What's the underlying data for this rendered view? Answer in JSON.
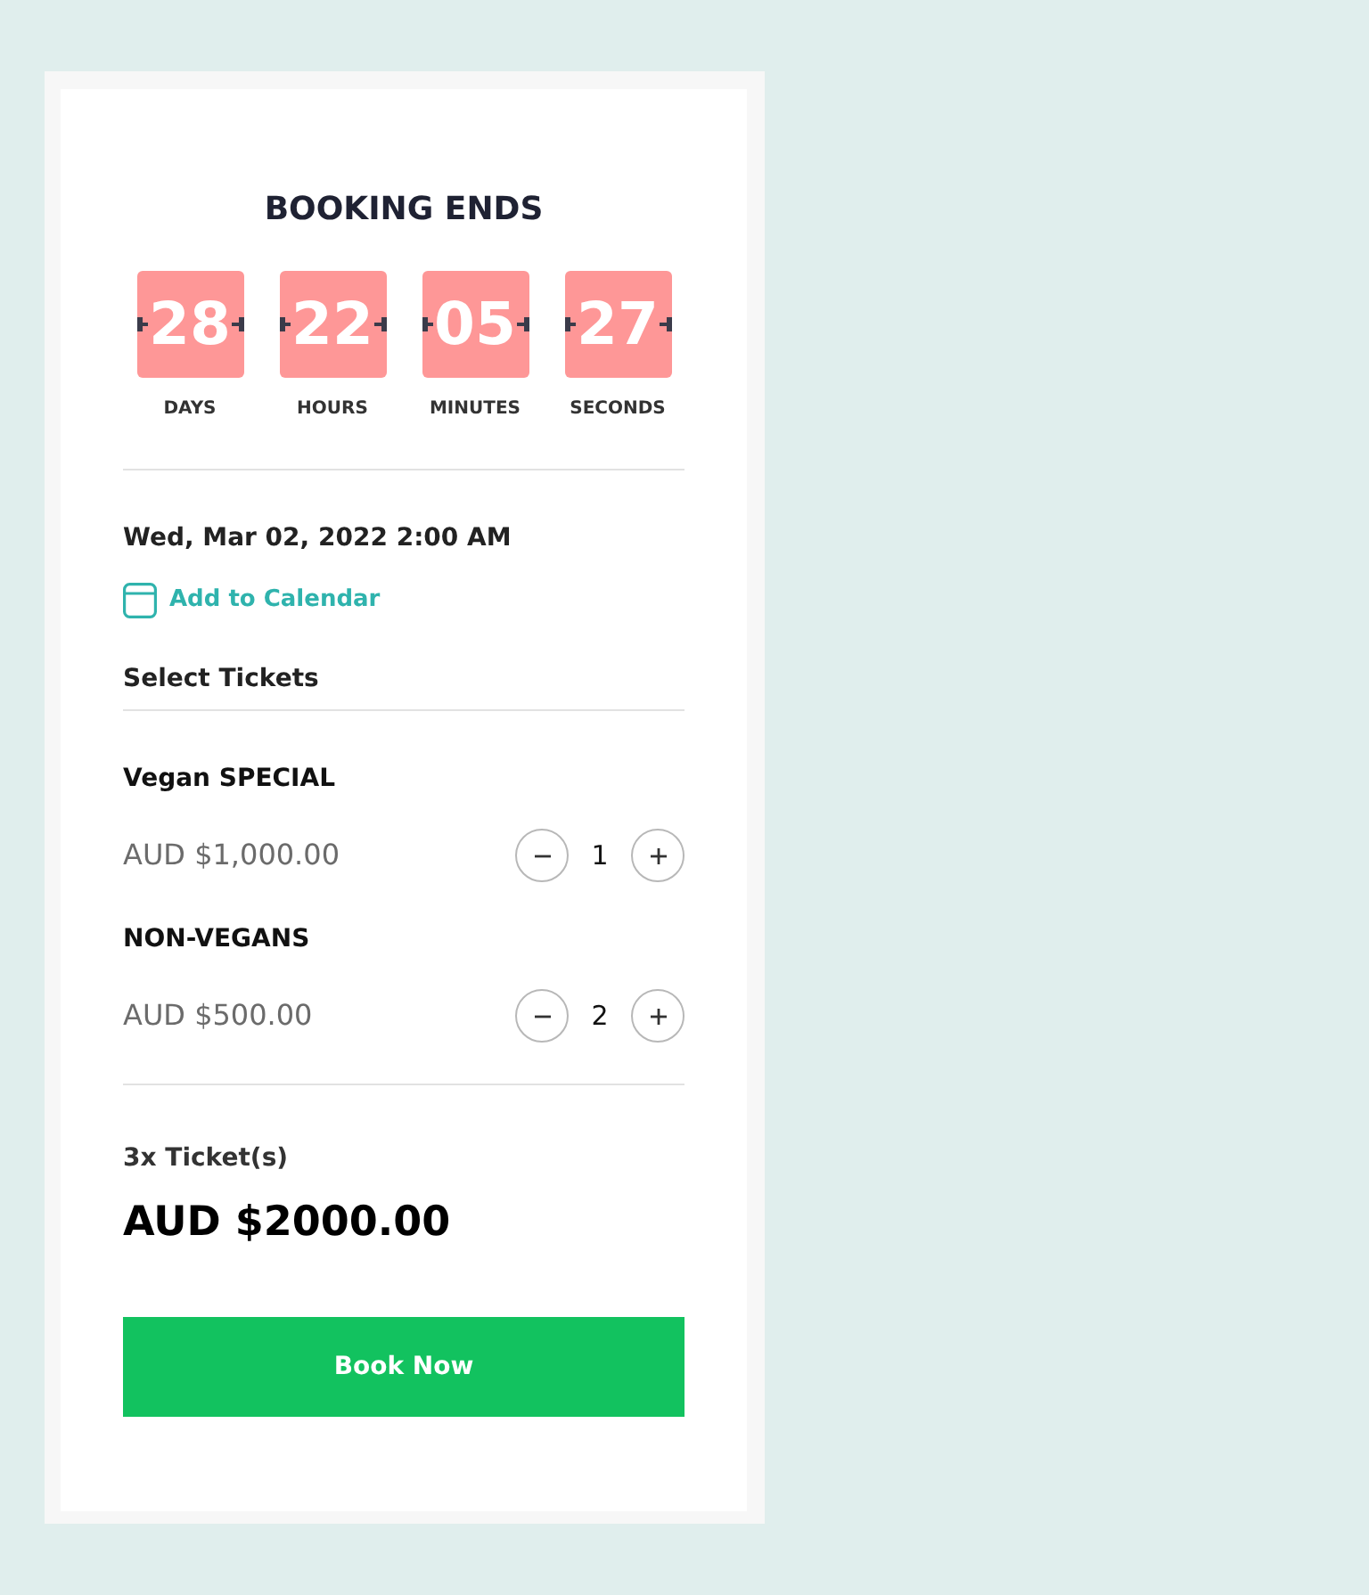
{
  "heading": "BOOKING ENDS",
  "countdown": [
    {
      "value": "28",
      "label": "DAYS"
    },
    {
      "value": "22",
      "label": "HOURS"
    },
    {
      "value": "05",
      "label": "MINUTES"
    },
    {
      "value": "27",
      "label": "SECONDS"
    }
  ],
  "date": "Wed, Mar 02, 2022 2:00 AM",
  "calendar_link": "Add to Calendar",
  "tickets_heading": "Select Tickets",
  "tickets": [
    {
      "name": "Vegan SPECIAL",
      "price": "AUD $1,000.00",
      "quantity": "1"
    },
    {
      "name": "NON-VEGANS",
      "price": "AUD $500.00",
      "quantity": "2"
    }
  ],
  "summary": {
    "count": "3x Ticket(s)",
    "total": "AUD $2000.00"
  },
  "book_button": "Book Now"
}
